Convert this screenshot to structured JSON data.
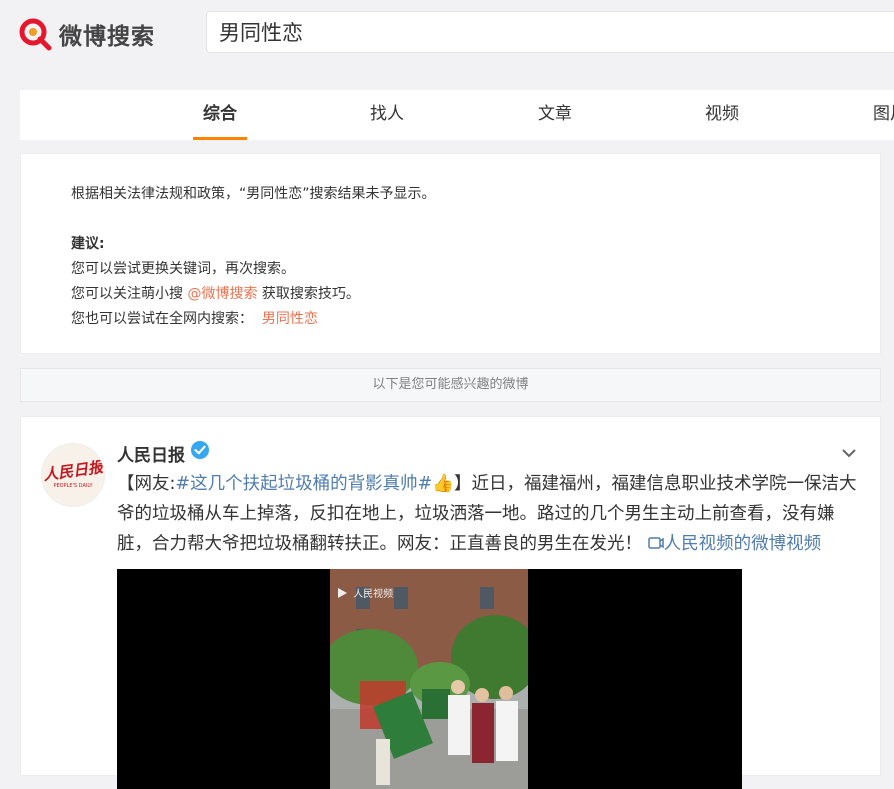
{
  "header": {
    "logo_text": "微博搜索",
    "search_value": "男同性恋"
  },
  "tabs": [
    {
      "label": "综合",
      "active": true
    },
    {
      "label": "找人",
      "active": false
    },
    {
      "label": "文章",
      "active": false
    },
    {
      "label": "视频",
      "active": false
    },
    {
      "label": "图片",
      "active": false
    }
  ],
  "notice": {
    "message": "根据相关法律法规和政策，“男同性恋”搜索结果未予显示。",
    "suggest_title": "建议:",
    "line1": "您可以尝试更换关键词，再次搜索。",
    "line2_prefix": "您可以关注萌小搜 ",
    "line2_link": "@微博搜索",
    "line2_suffix": " 获取搜索技巧。",
    "line3_prefix": "您也可以尝试在全网内搜索：",
    "line3_link": "男同性恋"
  },
  "banner": "以下是您可能感兴趣的微博",
  "post": {
    "author": "人民日报",
    "avatar_text": "人民日报",
    "avatar_sub": "PEOPLE'S DAILY",
    "text_start": "【网友:",
    "hashtag": "#这几个扶起垃圾桶的背影真帅#",
    "emoji": "👍",
    "text_body": "】近日，福建福州，福建信息职业技术学院一保洁大爷的垃圾桶从车上掉落，反扣在地上，垃圾洒落一地。路过的几个男生主动上前查看，没有嫌脏，合力帮大爷把垃圾桶翻转扶正。网友：正直善良的男生在发光！",
    "video_link": "人民视频的微博视频",
    "video_watermark": "人民视频"
  },
  "colors": {
    "accent_orange": "#ff8200",
    "link_orange": "#eb7350",
    "link_blue": "#507daf",
    "verified_blue": "#34a7ef"
  }
}
